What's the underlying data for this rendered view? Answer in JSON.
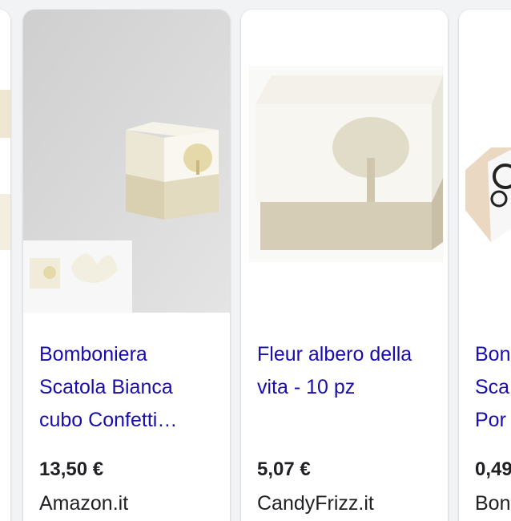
{
  "products": [
    {
      "title_lines": [
        "Bomboniera",
        "Scatola Bianca",
        "cubo Confetti…"
      ],
      "price": "13,50 €",
      "seller": "Amazon.it",
      "image_icon": "gift-box-tree-image"
    },
    {
      "title_lines": [
        "Fleur albero della",
        "vita - 10 pz"
      ],
      "price": "5,07 €",
      "seller": "CandyFrizz.it",
      "image_icon": "gift-box-tree-image"
    },
    {
      "title_lines": [
        "Bon",
        "Sca",
        "Por"
      ],
      "price": "0,49",
      "seller": "Bon",
      "image_icon": "gift-box-image"
    }
  ],
  "colors": {
    "link": "#1a0dab",
    "text": "#202124",
    "background": "#f1f3f4",
    "card": "#ffffff"
  }
}
